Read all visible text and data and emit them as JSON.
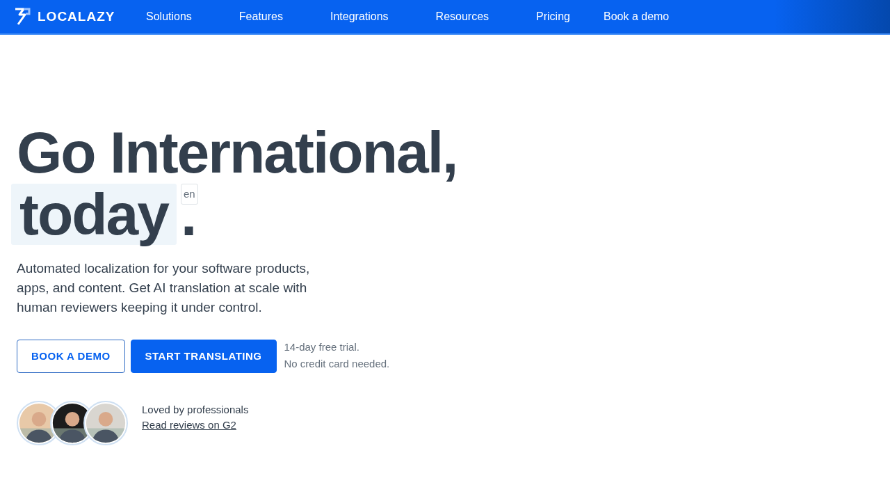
{
  "nav": {
    "logo": "LOCALAZY",
    "items": [
      "Solutions",
      "Features",
      "Integrations",
      "Resources",
      "Pricing",
      "Book a demo"
    ]
  },
  "hero": {
    "title_line": "Go International,",
    "highlight_word": "today",
    "language_tag": "en",
    "punctuation": ".",
    "description": "Automated localization for your software products, apps, and content. Get AI translation at scale with human reviewers keeping it under control.",
    "buttons": [
      {
        "label": "BOOK A DEMO",
        "kind": "outline"
      },
      {
        "label": "START TRANSLATING",
        "kind": "primary"
      }
    ],
    "trial_note": [
      "14-day free trial.",
      "No credit card needed."
    ],
    "social": {
      "text": "Loved by professionals",
      "link": "Read reviews on G2"
    }
  }
}
